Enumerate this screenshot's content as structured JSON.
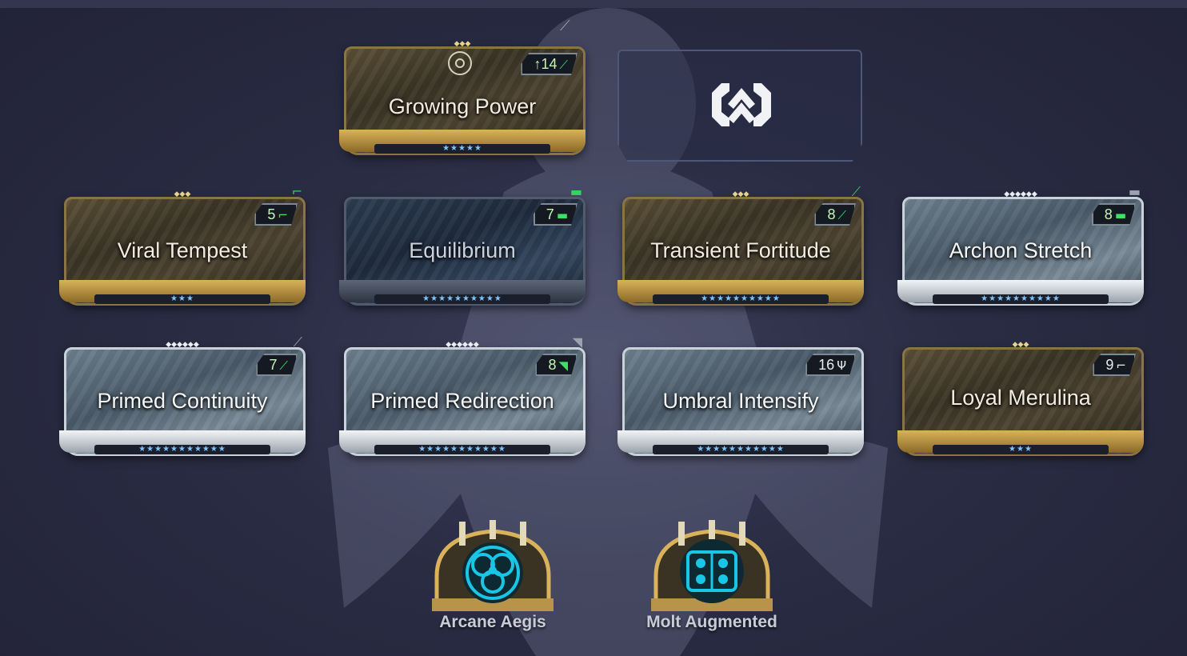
{
  "aura": {
    "name": "Growing Power",
    "drain": "↑14",
    "rank_stars": "★★★★★",
    "rarity": "gold"
  },
  "exilus": {
    "icon": "exilus-slot-icon"
  },
  "mods_row1": [
    {
      "name": "Viral Tempest",
      "drain": "5",
      "rank_stars": "★★★",
      "rarity": "gold"
    },
    {
      "name": "Equilibrium",
      "drain": "7",
      "rank_stars": "★★★★★★★★★★",
      "rarity": "blue"
    },
    {
      "name": "Transient Fortitude",
      "drain": "8",
      "rank_stars": "★★★★★★★★★★",
      "rarity": "gold"
    },
    {
      "name": "Archon Stretch",
      "drain": "8",
      "rank_stars": "★★★★★★★★★★",
      "rarity": "silver"
    }
  ],
  "mods_row2": [
    {
      "name": "Primed Continuity",
      "drain": "7",
      "rank_stars": "★★★★★★★★★★★",
      "rarity": "silver"
    },
    {
      "name": "Primed Redirection",
      "drain": "8",
      "rank_stars": "★★★★★★★★★★★",
      "rarity": "silver"
    },
    {
      "name": "Umbral Intensify",
      "drain": "16",
      "rank_stars": "★★★★★★★★★★★",
      "rarity": "silver"
    },
    {
      "name": "Loyal Merulina",
      "drain": "9",
      "rank_stars": "★★★",
      "rarity": "gold"
    }
  ],
  "arcanes": [
    {
      "name": "Arcane Aegis"
    },
    {
      "name": "Molt Augmented"
    }
  ],
  "colors": {
    "background": "#2a2c44",
    "polarity_green": "#3fe06a",
    "arcane_cyan": "#19c6e6",
    "gold": "#d9b25a"
  }
}
